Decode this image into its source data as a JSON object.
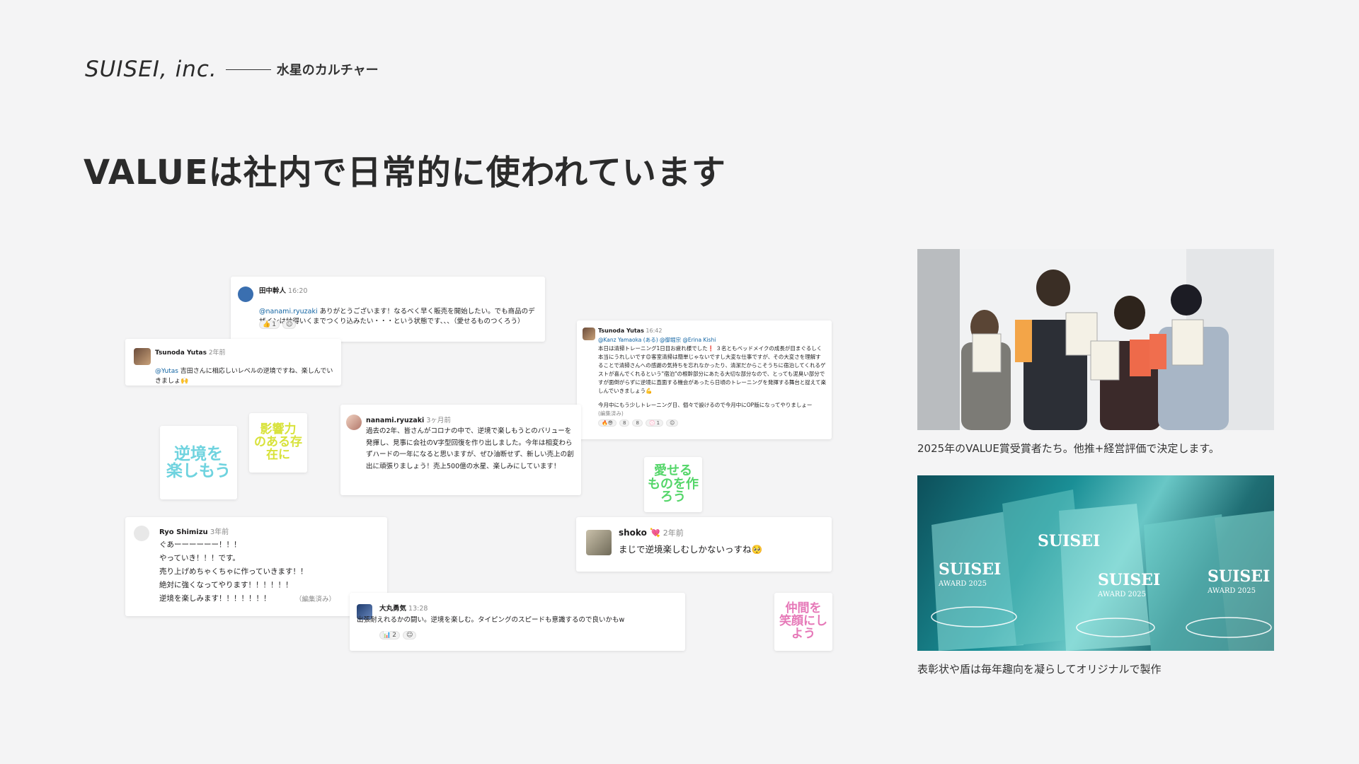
{
  "header": {
    "logo": "SUISEI, inc.",
    "section": "水星のカルチャー"
  },
  "headline": "VALUEは社内で日常的に使われています",
  "messages": {
    "tanaka": {
      "author": "田中幹人",
      "time": "16:20",
      "mention": "@nanami.ryuzaki",
      "text": " ありがとうございます！なるべく早く販売を開始したい。でも商品のデザインは納得いくまでつくり込みたい・・・という状態です、、、（愛せるものつくろう）",
      "reactions": [
        {
          "emoji": "👍",
          "count": "1"
        }
      ]
    },
    "tsunoda1": {
      "author": "Tsunoda Yutas",
      "time": "2年前",
      "mention": "@Yutas",
      "text": " 吉田さんに相応しいレベルの逆境ですね、楽しんでいきましょ🙌"
    },
    "tsunoda2": {
      "author": "Tsunoda Yutas",
      "time": "16:42",
      "mentions": "@Kanz Yamaoka (ある)  @御堀宗  @Erina Kishi",
      "text": "本日は清掃トレーニング1日目お疲れ様でした❗ ３名ともベッドメイクの成長が目まぐるしく本当にうれしいです😊客室清掃は簡単じゃないですし大変な仕事ですが、その大変さを理解することで清掃さんへの感謝の気持ちを忘れなかったり、清潔だからこそうちに宿泊してくれるゲストが喜んでくれるという\"宿泊\"の根幹部分にあたる大切な部分なので、とっても泥臭い部分ですが面倒がらずに逆境に直面する機会があったら日頃のトレーニングを発揮する舞台と捉えて楽しんでいきましょう💪",
      "text2": "今月中にもう少しトレーニング日、個々で設けるので今月中にOP版になってやりましょー",
      "edited": "(編集済み)",
      "reactions": [
        {
          "emoji": "🔥😎",
          "count": ""
        },
        {
          "emoji": "8",
          "count": ""
        },
        {
          "emoji": "8",
          "count": ""
        },
        {
          "emoji": "💮",
          "count": "1"
        }
      ]
    },
    "nanami": {
      "author": "nanami.ryuzaki",
      "time": "3ヶ月前",
      "text": "過去の2年、皆さんがコロナの中で、逆境で楽しもうとのバリューを発揮し、見事に会社のV字型回復を作り出しました。今年は相変わらずハードの一年になると思いますが、ぜひ油断せず、新しい売上の創出に頑張りましょう！売上500億の水星、楽しみにしています！"
    },
    "ryo": {
      "author": "Ryo Shimizu",
      "time": "3年前",
      "text": "ぐあーーーーーー！！！\nやっていき！！！です。\n売り上げめちゃくちゃに作っていきます！！\n絶対に強くなってやります！！！！！！\n逆境を楽しみます！！！！！！！",
      "edited": "（編集済み）"
    },
    "shoko": {
      "author": "shoko 💘",
      "time": "2年前",
      "text": "まじで逆境楽しむしかないっすね🥺"
    },
    "omaru": {
      "author": "大丸勇気",
      "time": "13:28",
      "text": "出張耐えれるかの闘い。逆境を楽しむ。タイピングのスピードも意識するので良いかもw",
      "reactions": [
        {
          "emoji": "📊",
          "count": "2"
        }
      ]
    }
  },
  "stickers": {
    "gyakkyo": "逆境を\n楽しもう",
    "eikyo": "影響力\nのある存在に",
    "aiseru": "愛せる\nものを作ろう",
    "nakama": "仲間を\n笑顔にしよう"
  },
  "photos": {
    "award_people_caption": "2025年のVALUE賞受賞者たち。他推+経営評価で決定します。",
    "trophies_caption": "表彰状や盾は毎年趣向を凝らしてオリジナルで製作",
    "trophy_brand": "SUISEI",
    "trophy_award": "AWARD 2025"
  },
  "colors": {
    "background": "#f4f4f5",
    "mention": "#1264a3",
    "sticker_cyan": "#6fd3df",
    "sticker_yellow": "#d8e23a",
    "sticker_green": "#55d66a",
    "sticker_pink": "#e679b8"
  }
}
